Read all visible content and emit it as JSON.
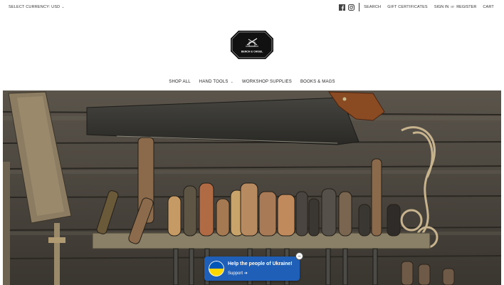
{
  "topbar": {
    "currency_label": "SELECT CURRENCY: USD",
    "social_icons": [
      "facebook-icon",
      "instagram-icon"
    ],
    "search": "SEARCH",
    "gift": "GIFT CERTIFICATES",
    "sign_in": "SIGN IN",
    "or": "or",
    "register": "REGISTER",
    "cart": "CART"
  },
  "brand": {
    "logo_text": "BENCH & CHISEL"
  },
  "nav": {
    "items": [
      {
        "label": "SHOP ALL"
      },
      {
        "label": "HAND TOOLS"
      },
      {
        "label": "WORKSHOP SUPPLIES"
      },
      {
        "label": "BOOKS & MAGS"
      }
    ]
  },
  "banner": {
    "title": "Help the people of Ukraine!",
    "support": "Support",
    "colors": {
      "blue": "#1f5fb8",
      "flag_blue": "#0057b7",
      "flag_yellow": "#ffd700"
    }
  }
}
